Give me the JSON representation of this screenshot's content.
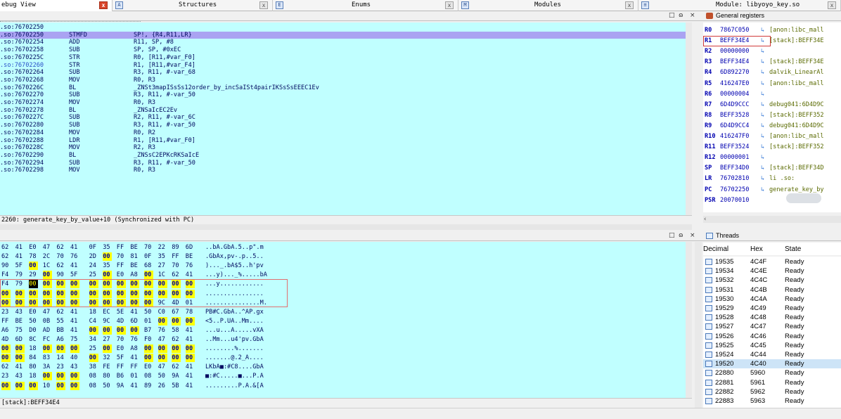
{
  "tabs": [
    {
      "label": "ebug View",
      "icon": "",
      "close": "x",
      "close_red": true
    },
    {
      "label": "Structures",
      "icon": "A",
      "close": "x"
    },
    {
      "label": "Enums",
      "icon": "E",
      "close": "x"
    },
    {
      "label": "Modules",
      "icon": "M",
      "close": "x"
    },
    {
      "label": "Module: libyoyo_key.so",
      "icon": "≡",
      "close": "x"
    }
  ],
  "pane_controls": {
    "restore": "□",
    "float": "ɷ",
    "close": "×"
  },
  "disasm": {
    "rows": [
      {
        "addr": ".so:76702250",
        "mn": "",
        "op": ""
      },
      {
        "addr": ".so:76702250",
        "mn": "STMFD",
        "op": "SP!, {R4,R11,LR}",
        "hl": true
      },
      {
        "addr": ".so:76702254",
        "mn": "ADD",
        "op": "R11, SP, #8"
      },
      {
        "addr": ".so:76702258",
        "mn": "SUB",
        "op": "SP, SP, #0xEC"
      },
      {
        "addr": ".so:7670225C",
        "mn": "STR",
        "op": "R0, [R11,#var_F0]"
      },
      {
        "addr": ".so:76702260",
        "mn": "STR",
        "op": "R1, [R11,#var_F4]",
        "pc": true
      },
      {
        "addr": ".so:76702264",
        "mn": "SUB",
        "op": "R3, R11, #-var_68"
      },
      {
        "addr": ".so:76702268",
        "mn": "MOV",
        "op": "R0, R3"
      },
      {
        "addr": ".so:7670226C",
        "mn": "BL",
        "op": "_ZNSt3mapISsSs12order_by_incSaISt4pairIKSsSsEEEC1Ev"
      },
      {
        "addr": ".so:76702270",
        "mn": "SUB",
        "op": "R3, R11, #-var_50"
      },
      {
        "addr": ".so:76702274",
        "mn": "MOV",
        "op": "R0, R3"
      },
      {
        "addr": ".so:76702278",
        "mn": "BL",
        "op": "_ZNSaIcEC2Ev"
      },
      {
        "addr": ".so:7670227C",
        "mn": "SUB",
        "op": "R2, R11, #-var_6C"
      },
      {
        "addr": ".so:76702280",
        "mn": "SUB",
        "op": "R3, R11, #-var_50"
      },
      {
        "addr": ".so:76702284",
        "mn": "MOV",
        "op": "R0, R2"
      },
      {
        "addr": ".so:76702288",
        "mn": "LDR",
        "op": "R1, [R11,#var_F0]"
      },
      {
        "addr": ".so:7670228C",
        "mn": "MOV",
        "op": "R2, R3"
      },
      {
        "addr": ".so:76702290",
        "mn": "BL",
        "op": "_ZNSsC2EPKcRKSaIcE"
      },
      {
        "addr": ".so:76702294",
        "mn": "SUB",
        "op": "R3, R11, #-var_50"
      },
      {
        "addr": ".so:76702298",
        "mn": "MOV",
        "op": "R0, R3"
      }
    ],
    "status": "2260: generate_key_by_value+10 (Synchronized with PC)"
  },
  "registers": {
    "title": "General registers",
    "rows": [
      {
        "name": "R0",
        "value": "7867C050",
        "arrow": "↳",
        "desc": "[anon:libc_mall"
      },
      {
        "name": "R1",
        "value": "BEFF34E4",
        "arrow": "↳",
        "desc": "[stack]:BEFF34E"
      },
      {
        "name": "R2",
        "value": "00000000",
        "arrow": "↳",
        "desc": ""
      },
      {
        "name": "R3",
        "value": "BEFF34E4",
        "arrow": "↳",
        "desc": "[stack]:BEFF34E"
      },
      {
        "name": "R4",
        "value": "6D892270",
        "arrow": "↳",
        "desc": "dalvik_LinearAl"
      },
      {
        "name": "R5",
        "value": "416247E0",
        "arrow": "↳",
        "desc": "[anon:libc_mall"
      },
      {
        "name": "R6",
        "value": "00000004",
        "arrow": "↳",
        "desc": ""
      },
      {
        "name": "R7",
        "value": "6D4D9CCC",
        "arrow": "↳",
        "desc": "debug041:6D4D9C"
      },
      {
        "name": "R8",
        "value": "BEFF3528",
        "arrow": "↳",
        "desc": "[stack]:BEFF352"
      },
      {
        "name": "R9",
        "value": "6D4D9CC4",
        "arrow": "↳",
        "desc": "debug041:6D4D9C"
      },
      {
        "name": "R10",
        "value": "416247F0",
        "arrow": "↳",
        "desc": "[anon:libc_mall"
      },
      {
        "name": "R11",
        "value": "BEFF3524",
        "arrow": "↳",
        "desc": "[stack]:BEFF352"
      },
      {
        "name": "R12",
        "value": "00000001",
        "arrow": "↳",
        "desc": ""
      },
      {
        "name": "SP",
        "value": "BEFF34D0",
        "arrow": "↳",
        "desc": "[stack]:BEFF34D"
      },
      {
        "name": "LR",
        "value": "76702810",
        "arrow": "↳",
        "desc": "li        .so:"
      },
      {
        "name": "PC",
        "value": "76702250",
        "arrow": "↳",
        "desc": "generate_key_by"
      },
      {
        "name": "PSR",
        "value": "20070010",
        "arrow": "",
        "desc": ""
      }
    ]
  },
  "hex": {
    "rows": [
      {
        "bytes": [
          "62",
          "41",
          "E0",
          "47",
          "62",
          "41",
          "0F",
          "35",
          "FF",
          "BE",
          "70",
          "22",
          "89",
          "6D"
        ],
        "ascii": "..bA.GbA.5..p\".m"
      },
      {
        "bytes": [
          "62",
          "41",
          "78",
          "2C",
          "70",
          "76",
          "2D",
          "00",
          "70",
          "81",
          "0F",
          "35",
          "FF",
          "BE"
        ],
        "ascii": ".GbAx,pv-.p..5.."
      },
      {
        "bytes": [
          "90",
          "5F",
          "00",
          "1C",
          "62",
          "41",
          "24",
          "35",
          "FF",
          "BE",
          "68",
          "27",
          "70",
          "76"
        ],
        "ascii": ")..._.bA$5..h'pv"
      },
      {
        "bytes": [
          "F4",
          "79",
          "29",
          "00",
          "90",
          "5F",
          "25",
          "00",
          "E0",
          "A8",
          "00",
          "1C",
          "62",
          "41"
        ],
        "ascii": "...y)..._%.....bA"
      },
      {
        "bytes": [
          "F4",
          "79",
          "00",
          "00",
          "00",
          "00",
          "00",
          "00",
          "00",
          "00",
          "00",
          "00",
          "00",
          "00"
        ],
        "ascii": "...y............"
      },
      {
        "bytes": [
          "00",
          "00",
          "00",
          "00",
          "00",
          "00",
          "00",
          "00",
          "00",
          "00",
          "00",
          "00",
          "00",
          "00"
        ],
        "ascii": "................"
      },
      {
        "bytes": [
          "00",
          "00",
          "00",
          "00",
          "00",
          "00",
          "00",
          "00",
          "00",
          "00",
          "00",
          "9C",
          "4D",
          "01"
        ],
        "ascii": "...............M."
      },
      {
        "bytes": [
          "23",
          "43",
          "E0",
          "47",
          "62",
          "41",
          "18",
          "EC",
          "5E",
          "41",
          "50",
          "C0",
          "67",
          "78"
        ],
        "ascii": "PB#C.GbA..^AP.gx"
      },
      {
        "bytes": [
          "FF",
          "BE",
          "50",
          "0B",
          "55",
          "41",
          "C4",
          "9C",
          "4D",
          "6D",
          "01",
          "00",
          "00",
          "00"
        ],
        "ascii": "<5..P.UA..Mm...."
      },
      {
        "bytes": [
          "A6",
          "75",
          "D0",
          "AD",
          "BB",
          "41",
          "00",
          "00",
          "00",
          "00",
          "B7",
          "76",
          "58",
          "41"
        ],
        "ascii": "...u...A.....vXA"
      },
      {
        "bytes": [
          "4D",
          "6D",
          "8C",
          "FC",
          "A6",
          "75",
          "34",
          "27",
          "70",
          "76",
          "F0",
          "47",
          "62",
          "41"
        ],
        "ascii": "..Mm...u4'pv.GbA"
      },
      {
        "bytes": [
          "00",
          "00",
          "18",
          "00",
          "00",
          "00",
          "25",
          "00",
          "E0",
          "A8",
          "00",
          "00",
          "00",
          "00"
        ],
        "ascii": "........%......."
      },
      {
        "bytes": [
          "00",
          "00",
          "84",
          "83",
          "14",
          "40",
          "00",
          "32",
          "5F",
          "41",
          "00",
          "00",
          "00",
          "00"
        ],
        "ascii": ".......@.2_A...."
      },
      {
        "bytes": [
          "62",
          "41",
          "80",
          "3A",
          "23",
          "43",
          "38",
          "FE",
          "FF",
          "FF",
          "E0",
          "47",
          "62",
          "41"
        ],
        "ascii": "LKbA■:#C8....GbA"
      },
      {
        "bytes": [
          "23",
          "43",
          "18",
          "00",
          "00",
          "00",
          "08",
          "80",
          "B6",
          "01",
          "08",
          "50",
          "9A",
          "41"
        ],
        "ascii": "■:#C.....■...P.A"
      },
      {
        "bytes": [
          "00",
          "00",
          "00",
          "10",
          "00",
          "00",
          "08",
          "50",
          "9A",
          "41",
          "89",
          "26",
          "5B",
          "41"
        ],
        "ascii": ".........P.A.&[A"
      }
    ],
    "status": "[stack]:BEFF34E4"
  },
  "threads": {
    "title": "Threads",
    "columns": [
      "Decimal",
      "Hex",
      "State"
    ],
    "rows": [
      {
        "dec": "19535",
        "hex": "4C4F",
        "state": "Ready"
      },
      {
        "dec": "19534",
        "hex": "4C4E",
        "state": "Ready"
      },
      {
        "dec": "19532",
        "hex": "4C4C",
        "state": "Ready"
      },
      {
        "dec": "19531",
        "hex": "4C4B",
        "state": "Ready"
      },
      {
        "dec": "19530",
        "hex": "4C4A",
        "state": "Ready"
      },
      {
        "dec": "19529",
        "hex": "4C49",
        "state": "Ready"
      },
      {
        "dec": "19528",
        "hex": "4C48",
        "state": "Ready"
      },
      {
        "dec": "19527",
        "hex": "4C47",
        "state": "Ready"
      },
      {
        "dec": "19526",
        "hex": "4C46",
        "state": "Ready"
      },
      {
        "dec": "19525",
        "hex": "4C45",
        "state": "Ready"
      },
      {
        "dec": "19524",
        "hex": "4C44",
        "state": "Ready"
      },
      {
        "dec": "19520",
        "hex": "4C40",
        "state": "Ready",
        "sel": true
      },
      {
        "dec": "22880",
        "hex": "5960",
        "state": "Ready"
      },
      {
        "dec": "22881",
        "hex": "5961",
        "state": "Ready"
      },
      {
        "dec": "22882",
        "hex": "5962",
        "state": "Ready"
      },
      {
        "dec": "22883",
        "hex": "5963",
        "state": "Ready"
      }
    ]
  },
  "colors": {
    "disasm_bg": "#c0ffff",
    "highlight": "#aaa3f2",
    "hex_yellow": "#ffff00"
  }
}
